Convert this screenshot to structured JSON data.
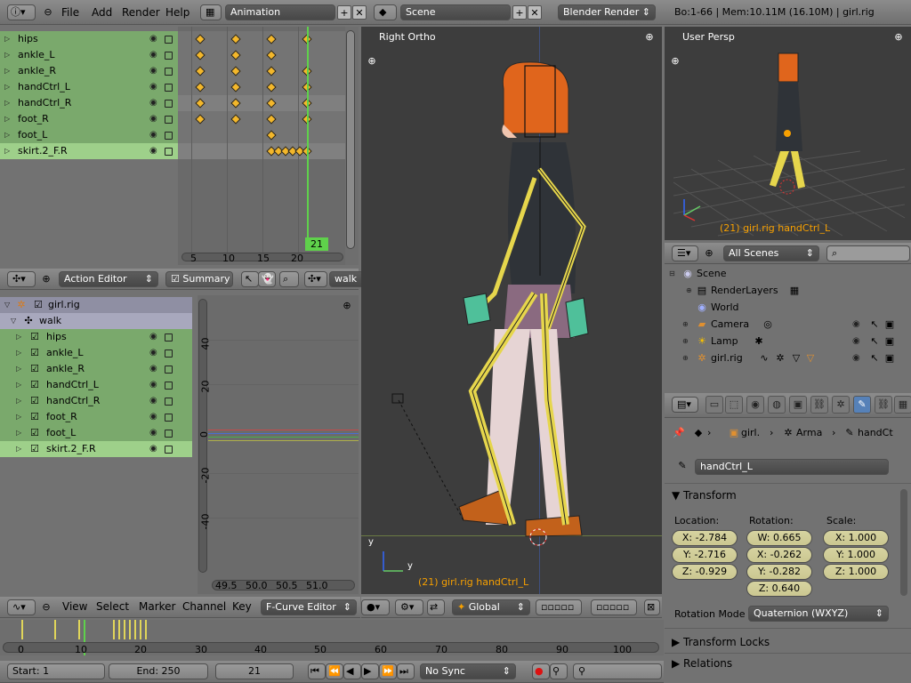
{
  "topbar": {
    "menus": [
      "File",
      "Add",
      "Render",
      "Help"
    ],
    "screen_layout": "Animation",
    "scene": "Scene",
    "render_engine": "Blender Render",
    "stats": "Bo:1-66 | Mem:10.11M (16.10M) | girl.rig"
  },
  "dopesheet": {
    "channels": [
      "hips",
      "ankle_L",
      "ankle_R",
      "handCtrl_L",
      "handCtrl_R",
      "foot_R",
      "foot_L",
      "skirt.2_F.R"
    ],
    "selected_channel": "skirt.2_F.R",
    "frame_ticks": [
      "5",
      "10",
      "15",
      "20"
    ],
    "current_frame": "21",
    "mode": "Action Editor",
    "summary_label": "Summary",
    "action_name": "walk"
  },
  "graph_editor": {
    "object": "girl.rig",
    "action": "walk",
    "channels": [
      "hips",
      "ankle_L",
      "ankle_R",
      "handCtrl_L",
      "handCtrl_R",
      "foot_R",
      "foot_L",
      "skirt.2_F.R"
    ],
    "y_ticks": [
      "40",
      "20",
      "0",
      "-20",
      "-40"
    ],
    "x_ticks": [
      "49.5",
      "50.0",
      "50.5",
      "51.0"
    ],
    "menus": [
      "View",
      "Select",
      "Marker",
      "Channel",
      "Key"
    ],
    "mode": "F-Curve Editor"
  },
  "viewport_main": {
    "label": "Right Ortho",
    "status": "(21) girl.rig handCtrl_L",
    "orientation": "Global"
  },
  "viewport_user": {
    "label": "User Persp",
    "status": "(21) girl.rig handCtrl_L"
  },
  "outliner": {
    "filter": "All Scenes",
    "items": [
      {
        "label": "Scene",
        "icon": "scene-icon"
      },
      {
        "label": "RenderLayers",
        "icon": "renderlayers-icon"
      },
      {
        "label": "World",
        "icon": "world-icon"
      },
      {
        "label": "Camera",
        "icon": "camera-icon"
      },
      {
        "label": "Lamp",
        "icon": "lamp-icon"
      },
      {
        "label": "girl.rig",
        "icon": "armature-icon"
      }
    ]
  },
  "properties": {
    "breadcrumb": [
      "girl.",
      "Arma",
      "handCt"
    ],
    "bone_name": "handCtrl_L",
    "transform_title": "Transform",
    "location_label": "Location:",
    "rotation_label": "Rotation:",
    "scale_label": "Scale:",
    "location": [
      "X: -2.784",
      "Y: -2.716",
      "Z: -0.929"
    ],
    "rotation": [
      "W: 0.665",
      "X: -0.262",
      "Y: -0.282",
      "Z: 0.640"
    ],
    "scale": [
      "X: 1.000",
      "Y: 1.000",
      "Z: 1.000"
    ],
    "rotation_mode_label": "Rotation Mode",
    "rotation_mode": "Quaternion (WXYZ)",
    "transform_locks": "Transform Locks",
    "relations": "Relations"
  },
  "timeline": {
    "ticks": [
      "0",
      "10",
      "20",
      "30",
      "40",
      "50",
      "60",
      "70",
      "80",
      "90",
      "100"
    ],
    "start": "Start: 1",
    "end": "End: 250",
    "current": "21",
    "sync": "No Sync"
  },
  "colors": {
    "accent": "#f3b72b",
    "selection_green": "#8fc47a",
    "viewport_bg": "#3d3d3d",
    "field_yellow": "#d2cf98"
  }
}
